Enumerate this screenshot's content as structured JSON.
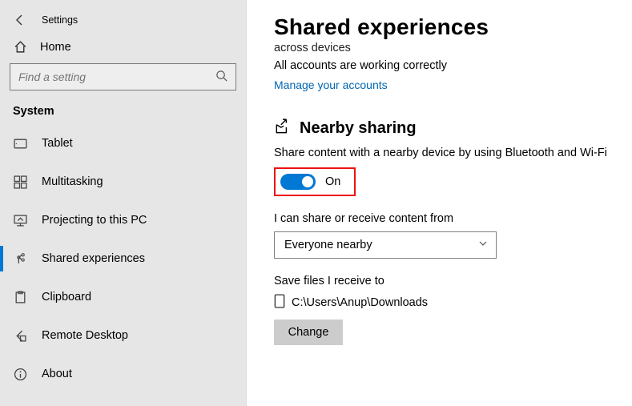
{
  "header": {
    "app_title": "Settings"
  },
  "sidebar": {
    "home_label": "Home",
    "search_placeholder": "Find a setting",
    "section_title": "System",
    "items": [
      {
        "label": "Tablet",
        "icon": "tablet-icon"
      },
      {
        "label": "Multitasking",
        "icon": "multitasking-icon"
      },
      {
        "label": "Projecting to this PC",
        "icon": "projecting-icon"
      },
      {
        "label": "Shared experiences",
        "icon": "share-icon",
        "selected": true
      },
      {
        "label": "Clipboard",
        "icon": "clipboard-icon"
      },
      {
        "label": "Remote Desktop",
        "icon": "remote-desktop-icon"
      },
      {
        "label": "About",
        "icon": "about-icon"
      }
    ]
  },
  "main": {
    "title": "Shared experiences",
    "truncated_line": "across devices",
    "accounts_status": "All accounts are working correctly",
    "manage_link": "Manage your accounts",
    "nearby": {
      "heading": "Nearby sharing",
      "description": "Share content with a nearby device by using Bluetooth and Wi-Fi",
      "toggle_state": "On",
      "toggle_on": true,
      "share_from_label": "I can share or receive content from",
      "share_from_value": "Everyone nearby",
      "save_to_label": "Save files I receive to",
      "save_to_path": "C:\\Users\\Anup\\Downloads",
      "change_label": "Change"
    }
  }
}
